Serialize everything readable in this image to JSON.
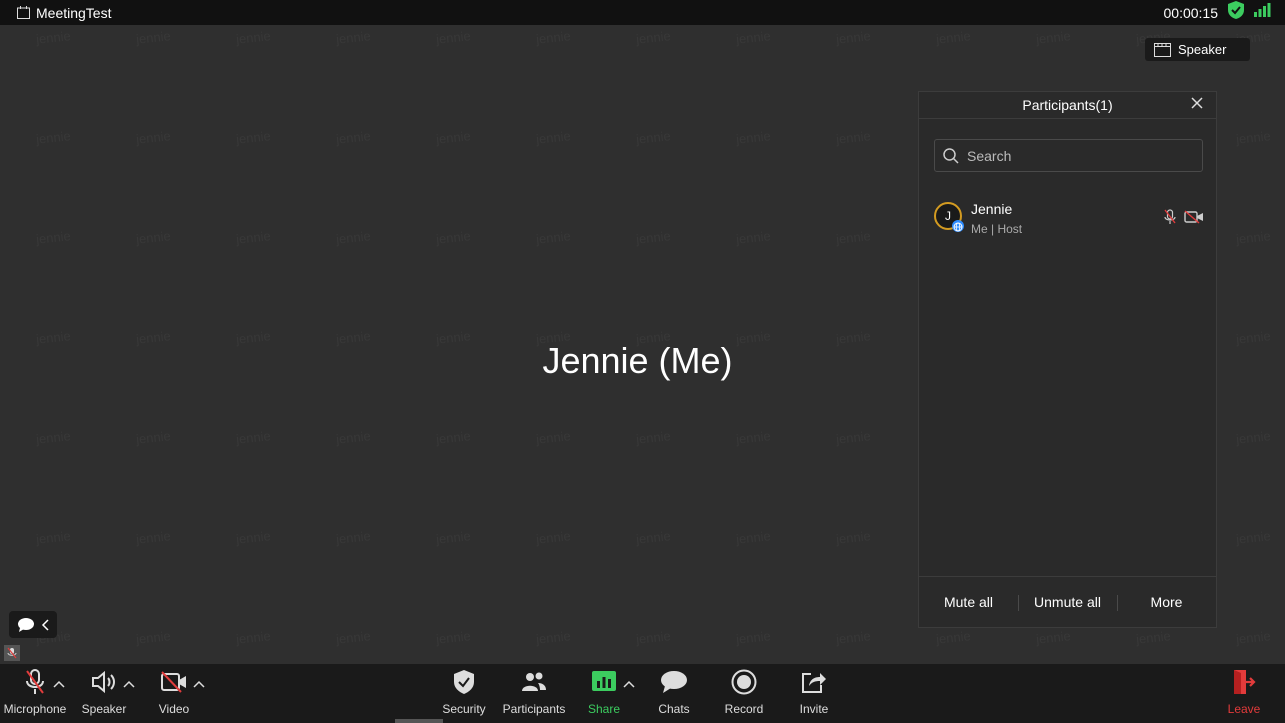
{
  "window": {
    "title": "MeetingTest",
    "timer": "00:00:15"
  },
  "view": {
    "speaker_label": "Speaker"
  },
  "main": {
    "display_name": "Jennie (Me)",
    "watermark": "jennie"
  },
  "participants_panel": {
    "title": "Participants(1)",
    "search_placeholder": "Search",
    "participants": [
      {
        "initial": "J",
        "name": "Jennie",
        "role": "Me | Host",
        "mic": "muted",
        "video": "off"
      }
    ],
    "footer": {
      "mute_all": "Mute all",
      "unmute_all": "Unmute all",
      "more": "More"
    }
  },
  "toolbar": {
    "microphone": "Microphone",
    "speaker": "Speaker",
    "video": "Video",
    "security": "Security",
    "participants": "Participants",
    "share": "Share",
    "chats": "Chats",
    "record": "Record",
    "invite": "Invite",
    "leave": "Leave"
  },
  "colors": {
    "accent_green": "#3ccc5f",
    "leave_red": "#e23b3b",
    "mute_red": "#e03c3c",
    "avatar_ring": "#d39b21"
  }
}
